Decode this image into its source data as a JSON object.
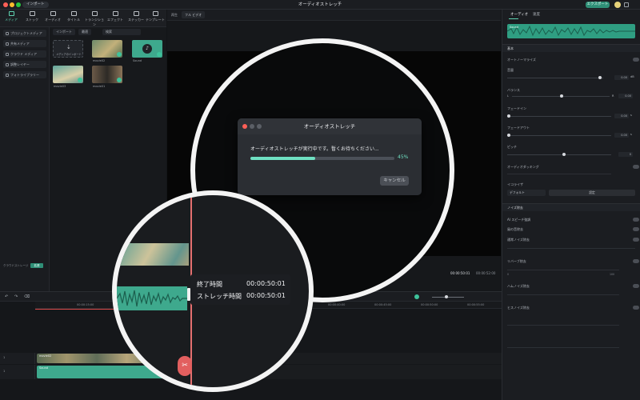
{
  "titlebar": {
    "import_label": "インポート",
    "title": "オーディオストレッチ",
    "export_label": "エクスポート",
    "colors": {
      "close": "#ff5f57",
      "minimize": "#febc2e",
      "zoom": "#28c840"
    }
  },
  "toolbar": {
    "tabs": [
      {
        "label": "メディア",
        "icon": "media-icon"
      },
      {
        "label": "ストック",
        "icon": "stock-icon"
      },
      {
        "label": "オーディオ",
        "icon": "music-note-icon"
      },
      {
        "label": "タイトル",
        "icon": "text-icon"
      },
      {
        "label": "トランジション",
        "icon": "transition-icon"
      },
      {
        "label": "エフェクト",
        "icon": "effect-icon"
      },
      {
        "label": "ステッカー",
        "icon": "sticker-icon"
      },
      {
        "label": "テンプレート",
        "icon": "template-icon"
      }
    ]
  },
  "sidebar": {
    "items": [
      {
        "label": "プロジェクトメディア"
      },
      {
        "label": "共有メディア"
      },
      {
        "label": "クラウド メディア"
      },
      {
        "label": "調整レイヤー"
      },
      {
        "label": "フォトライブラリー"
      }
    ],
    "footer_label": "クラウドストレージ",
    "footer_button": "拡張"
  },
  "media": {
    "import_dropdown": "インポート",
    "filter_label": "最適",
    "search_placeholder": "検索",
    "import_tile_label": "メディアのインポート",
    "items": [
      {
        "label": "movie02"
      },
      {
        "label": "Sound"
      },
      {
        "label": "movie03"
      },
      {
        "label": "movie01"
      }
    ]
  },
  "preview": {
    "player_label": "再生",
    "quality_label": "フル ビデオ",
    "timecode": "00:00:50:01",
    "duration": "00:00:52:00"
  },
  "right_panel": {
    "tabs": [
      "オーディオ",
      "速度"
    ],
    "clip_name": "Sound",
    "basic_header": "基本",
    "rows": [
      {
        "label": "オートノーマライズ"
      },
      {
        "label": "音量",
        "value": "0.00",
        "unit": "dB"
      },
      {
        "label": "バランス",
        "left": "L",
        "right": "R",
        "value": "0.00"
      },
      {
        "label": "フェードイン",
        "value": "0.00",
        "unit": "s"
      },
      {
        "label": "フェードアウト",
        "value": "0.00",
        "unit": "s"
      },
      {
        "label": "ピッチ",
        "value": "0"
      },
      {
        "label": "オーディオダッキング"
      }
    ],
    "eq_label": "イコライザ",
    "eq_value": "デフォルト",
    "eq_button": "設定",
    "noise_header": "ノイズ除去",
    "noise_rows": [
      {
        "label": "AI スピーチ強調"
      },
      {
        "label": "風の音除去"
      },
      {
        "label": "通常ノイズ除去"
      },
      {
        "label": "リバーブ除去"
      },
      {
        "label": "ハムノイズ除去"
      },
      {
        "label": "ヒスノイズ除去"
      }
    ],
    "scale_low": "0",
    "scale_high": "100"
  },
  "timeline": {
    "ruler": [
      "00:00:15:00",
      "00:00:40:00",
      "00:00:45:00",
      "00:00:50:00",
      "00:00:55:00"
    ],
    "track_labels": [
      "1",
      "1"
    ],
    "video_clip_label": "movie02",
    "audio_clip_label": "Sound"
  },
  "dialog": {
    "title": "オーディオストレッチ",
    "message": "オーディオストレッチが実行中です。暫くお待ちください...",
    "progress": 45,
    "progress_label": "45%",
    "cancel_label": "キャンセル"
  },
  "readout": {
    "end_label": "終了時間",
    "end_value": "00:00:50:01",
    "stretch_label": "ストレッチ時間",
    "stretch_value": "00:00:50:01"
  }
}
